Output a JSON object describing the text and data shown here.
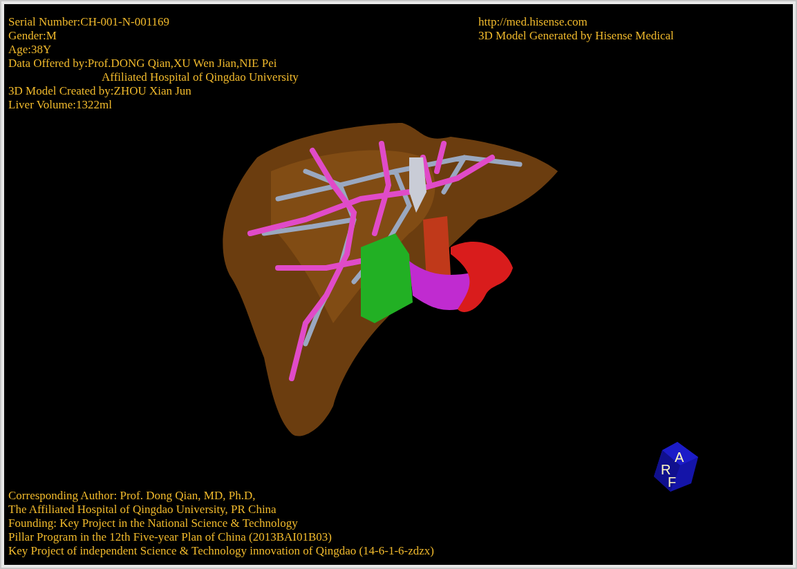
{
  "case_info": [
    {
      "kind": "line",
      "text": "Serial Number:CH-001-N-001169"
    },
    {
      "kind": "line",
      "text": "Gender:M"
    },
    {
      "kind": "line",
      "text": "Age:38Y"
    },
    {
      "kind": "line",
      "text": "Data Offered by:Prof.DONG Qian,XU Wen Jian,NIE Pei"
    },
    {
      "kind": "continuation",
      "text": "Affiliated Hospital of Qingdao University"
    },
    {
      "kind": "line",
      "text": "3D Model Created by:ZHOU Xian Jun"
    },
    {
      "kind": "line",
      "text": "Liver Volume:1322ml"
    }
  ],
  "vendor": {
    "url": "http://med.hisense.com",
    "credit": "3D Model Generated by Hisense Medical"
  },
  "orientation_cube": {
    "faces": [
      "R",
      "A",
      "F"
    ]
  },
  "credits": [
    "Corresponding Author: Prof. Dong Qian, MD, Ph.D,",
    "The Affiliated Hospital of Qingdao University, PR China",
    "Founding: Key Project in the National Science & Technology",
    "Pillar Program in the 12th Five-year Plan of China (2013BAI01B03)",
    "Key Project of independent Science & Technology innovation of Qingdao (14-6-1-6-zdzx)"
  ]
}
